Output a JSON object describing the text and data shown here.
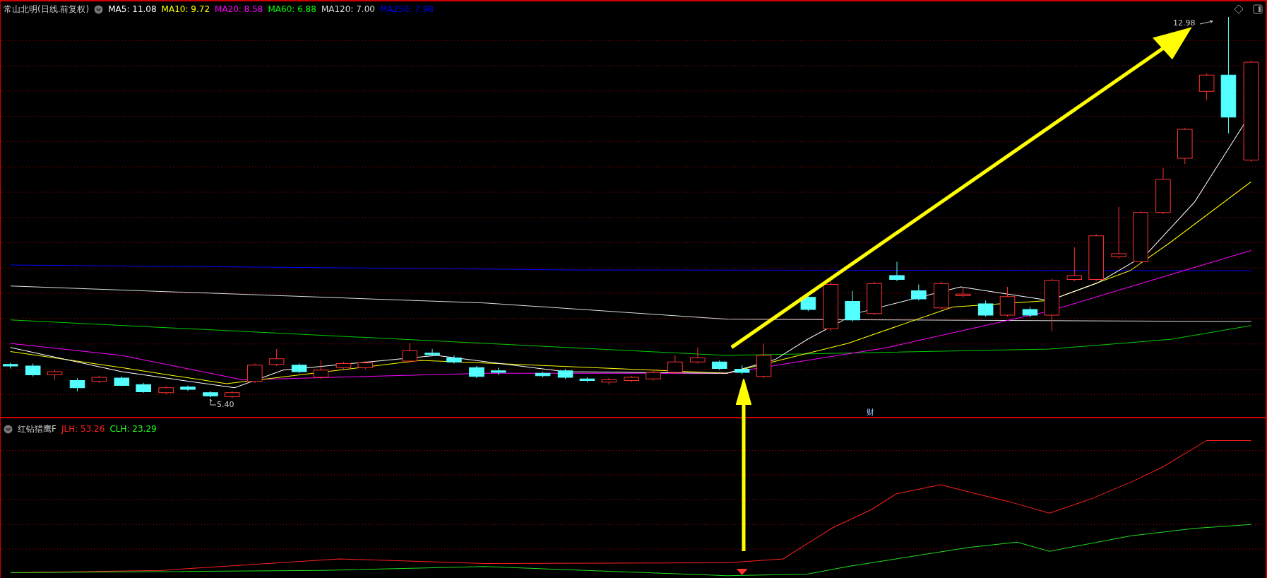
{
  "chart_header": {
    "title": "常山北明(日线.前复权)",
    "indicators": [
      {
        "label": "MA5: 11.08",
        "color": "#ffffff"
      },
      {
        "label": "MA10: 9.72",
        "color": "#ffff00"
      },
      {
        "label": "MA20: 8.58",
        "color": "#ff00ff"
      },
      {
        "label": "MA60: 6.88",
        "color": "#00ff00"
      },
      {
        "label": "MA120: 7.00",
        "color": "#dddddd"
      },
      {
        "label": "MA250: 7.98",
        "color": "#0000ff"
      }
    ]
  },
  "price_labels": {
    "high": "12.98",
    "low": "5.40"
  },
  "event_marker": "财",
  "indicator_pane": {
    "title": "红钻猎鹰F",
    "values": [
      {
        "label": "JLH: 53.26",
        "color": "#ff2020"
      },
      {
        "label": "CLH: 23.29",
        "color": "#20ff20"
      }
    ]
  }
}
